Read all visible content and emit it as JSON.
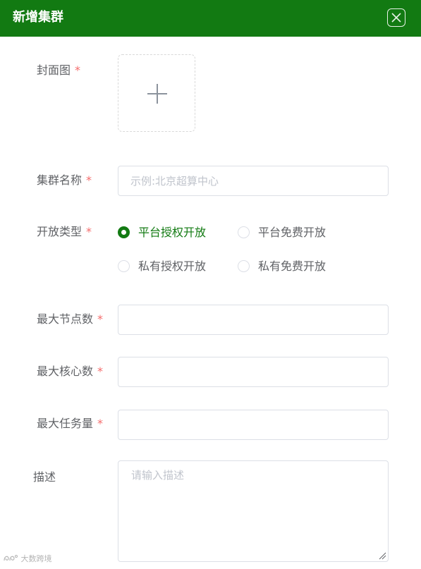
{
  "dialog": {
    "title": "新增集群",
    "close_icon": "close-icon"
  },
  "form": {
    "cover": {
      "label": "封面图",
      "required_mark": "*",
      "upload_icon": "plus-icon"
    },
    "cluster_name": {
      "label": "集群名称",
      "required_mark": "*",
      "value": "",
      "placeholder": "示例:北京超算中心"
    },
    "open_type": {
      "label": "开放类型",
      "required_mark": "*",
      "options": [
        "平台授权开放",
        "平台免费开放",
        "私有授权开放",
        "私有免费开放"
      ],
      "selected": "平台授权开放"
    },
    "max_nodes": {
      "label": "最大节点数",
      "required_mark": "*",
      "value": ""
    },
    "max_cores": {
      "label": "最大核心数",
      "required_mark": "*",
      "value": ""
    },
    "max_tasks": {
      "label": "最大任务量",
      "required_mark": "*",
      "value": ""
    },
    "description": {
      "label": "描述",
      "value": "",
      "placeholder": "请输入描述"
    }
  },
  "watermark": {
    "text": "大数跨境"
  },
  "colors": {
    "primary": "#127a12",
    "required": "#f56c6c",
    "border": "#dcdfe6",
    "placeholder": "#c0c4cc"
  }
}
